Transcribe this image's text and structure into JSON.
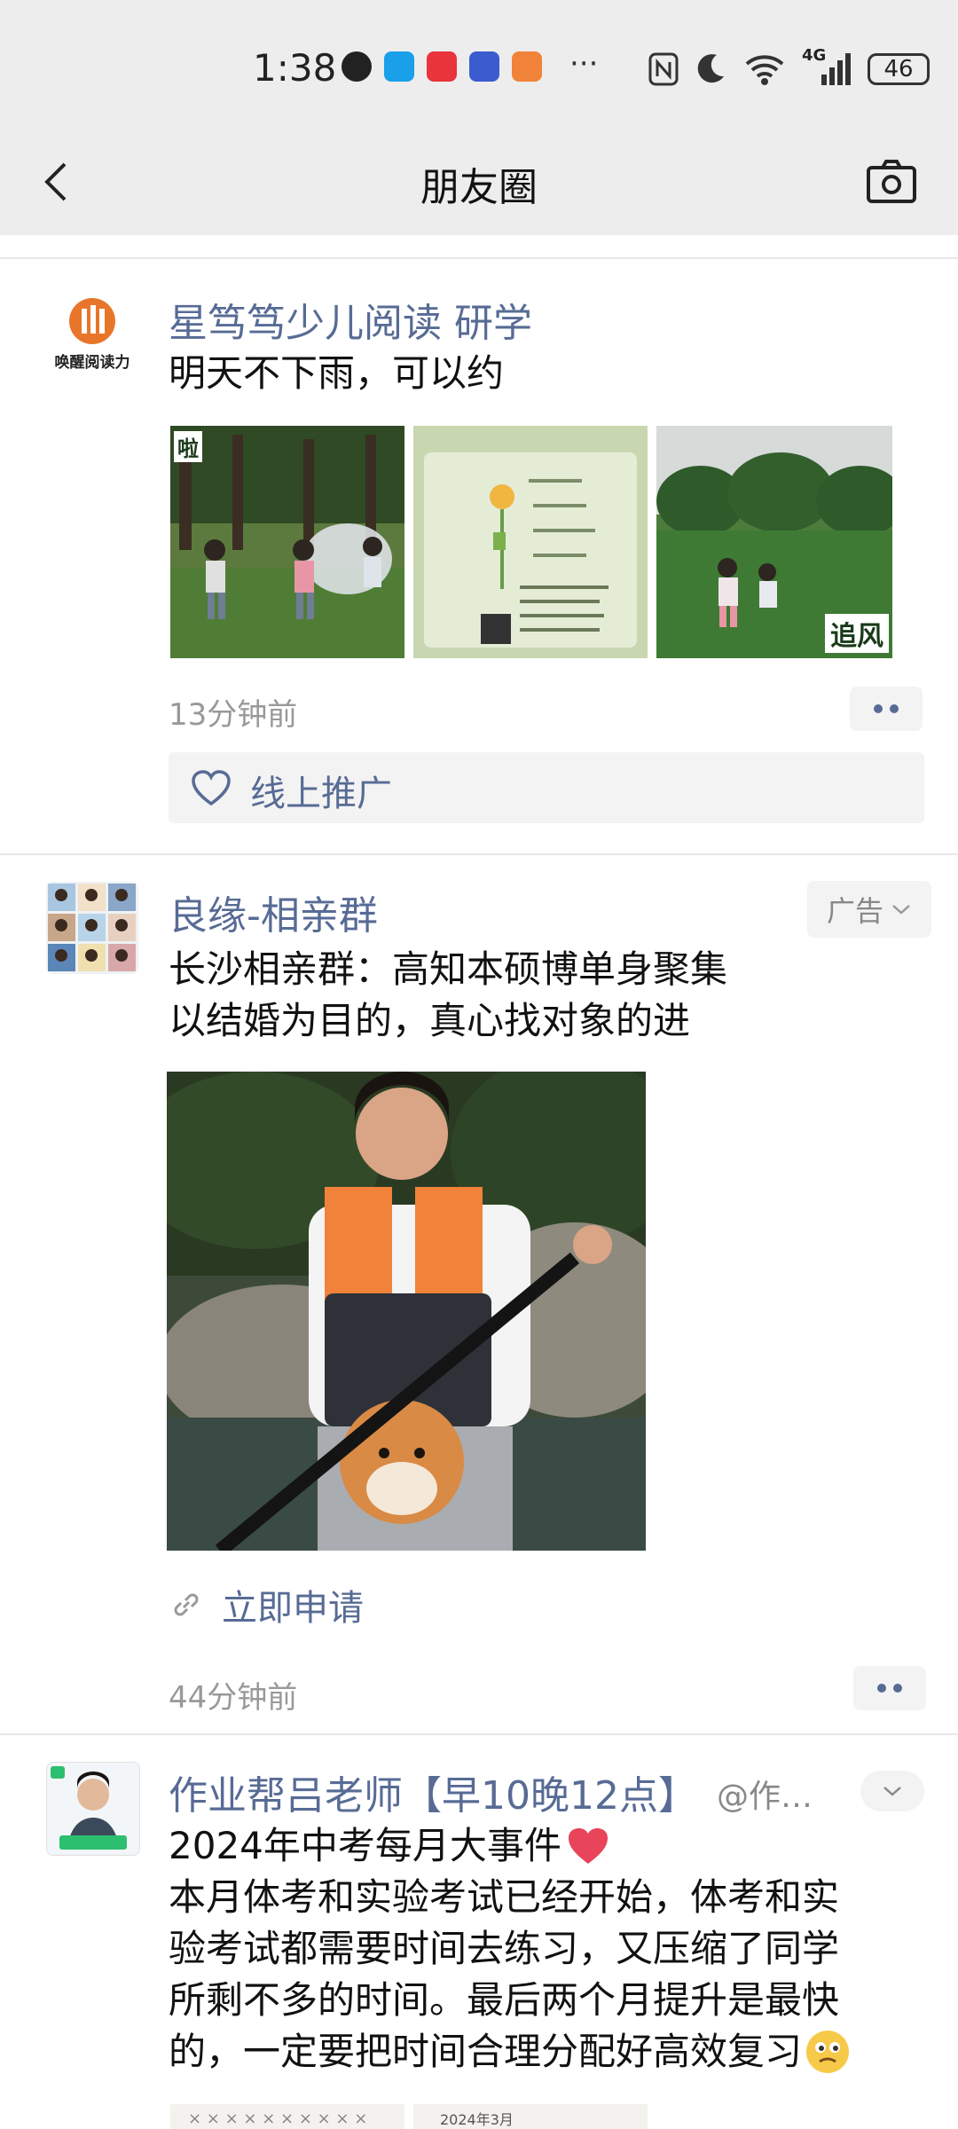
{
  "status_bar": {
    "time": "1:38",
    "battery": "46",
    "network": "4G"
  },
  "nav": {
    "title": "朋友圈"
  },
  "posts": [
    {
      "name": "星笃笃少儿阅读  研学",
      "avatar_text": "唤醒阅读力",
      "text": "明天不下雨，可以约",
      "images": [
        {
          "caption": "啦"
        },
        {
          "caption": ""
        },
        {
          "caption": "追风"
        }
      ],
      "time": "13分钟前",
      "like_text": "线上推广"
    },
    {
      "name": "良缘-相亲群",
      "ad_label": "广告",
      "text_lines": [
        "长沙相亲群：高知本硕博单身聚集",
        "以结婚为目的，真心找对象的进"
      ],
      "link_text": "立即申请",
      "time": "44分钟前"
    },
    {
      "name": "作业帮吕老师【早10晚12点】",
      "handle": "@作…",
      "text_lines": [
        "2024年中考每月大事件",
        "本月体考和实验考试已经开始，体考和实",
        "验考试都需要时间去练习，又压缩了同学",
        "所剩不多的时间。最后两个月提升是最快",
        "的，一定要把时间合理分配好高效复习"
      ],
      "thumb_caption": "2024年3月"
    }
  ],
  "colors": {
    "link": "#576b95",
    "background": "#ffffff",
    "header": "#ededed"
  }
}
